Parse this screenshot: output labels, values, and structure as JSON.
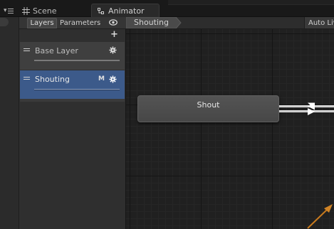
{
  "tabs": {
    "menu_icon": "dropdown-menu-icon",
    "scene": {
      "label": "Scene",
      "icon": "grid-hash-icon"
    },
    "animator": {
      "label": "Animator",
      "icon": "animator-icon"
    }
  },
  "layers_panel": {
    "tabs": [
      {
        "label": "Layers",
        "active": true
      },
      {
        "label": "Parameters",
        "active": false
      }
    ],
    "visibility_icon": "eye-icon",
    "add_icon_glyph": "+",
    "layers": [
      {
        "name": "Base Layer",
        "selected": false,
        "badge": ""
      },
      {
        "name": "Shouting",
        "selected": true,
        "badge": "M"
      }
    ]
  },
  "graph": {
    "breadcrumb": "Shouting",
    "auto_live_label": "Auto Live",
    "states": [
      {
        "name": "Shout"
      }
    ]
  },
  "colors": {
    "selected_layer": "#3c5a8a",
    "transition_orange": "#c87a1e",
    "state_node": "#4e4e4e"
  }
}
